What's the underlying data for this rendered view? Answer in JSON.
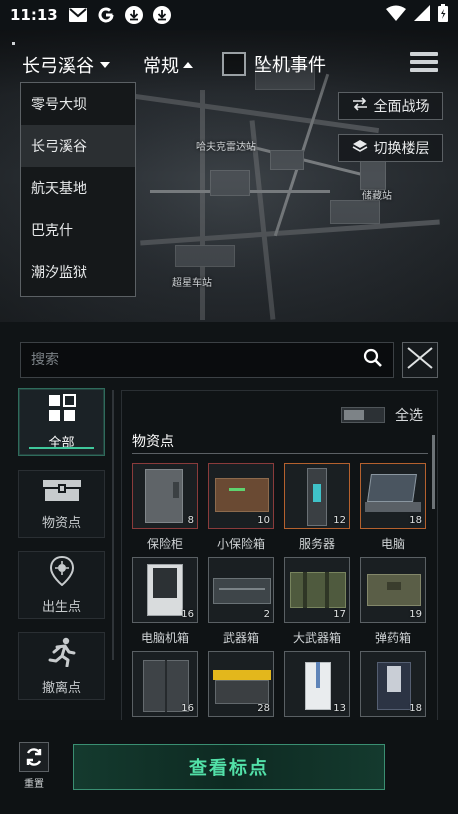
{
  "status_bar": {
    "time": "11:13",
    "icons": [
      "gmail-icon",
      "google-icon",
      "download-icon",
      "download-icon",
      "wifi-icon",
      "signal-icon",
      "battery-icon"
    ]
  },
  "header": {
    "map_selected": "长弓溪谷",
    "mode": "常规",
    "crash_event_label": "坠机事件"
  },
  "map_dropdown": {
    "options": [
      "零号大坝",
      "长弓溪谷",
      "航天基地",
      "巴克什",
      "潮汐监狱"
    ],
    "selected": "长弓溪谷"
  },
  "map_buttons": {
    "full_battlefield": "全面战场",
    "switch_floor": "切换楼层"
  },
  "map_places": {
    "p1": "哈夫克雷达站",
    "p2": "储藏站",
    "p3": "超星车站"
  },
  "search": {
    "placeholder": "搜索"
  },
  "categories": [
    {
      "label": "全部",
      "icon": "grid-icon",
      "active": true
    },
    {
      "label": "物资点",
      "icon": "crate-icon",
      "active": false
    },
    {
      "label": "出生点",
      "icon": "spawn-pin-icon",
      "active": false
    },
    {
      "label": "撤离点",
      "icon": "running-man-icon",
      "active": false
    }
  ],
  "grid": {
    "select_all": "全选",
    "section_title": "物资点",
    "items": [
      {
        "label": "保险柜",
        "count": "8",
        "frame": "red"
      },
      {
        "label": "小保险箱",
        "count": "10",
        "frame": "red"
      },
      {
        "label": "服务器",
        "count": "12",
        "frame": "orange"
      },
      {
        "label": "电脑",
        "count": "18",
        "frame": "orange"
      },
      {
        "label": "电脑机箱",
        "count": "16",
        "frame": "grey"
      },
      {
        "label": "武器箱",
        "count": "2",
        "frame": "grey"
      },
      {
        "label": "大武器箱",
        "count": "17",
        "frame": "grey"
      },
      {
        "label": "弹药箱",
        "count": "19",
        "frame": "grey"
      },
      {
        "label": "",
        "count": "16",
        "frame": "grey"
      },
      {
        "label": "",
        "count": "28",
        "frame": "grey"
      },
      {
        "label": "",
        "count": "13",
        "frame": "grey"
      },
      {
        "label": "",
        "count": "18",
        "frame": "grey"
      }
    ]
  },
  "footer": {
    "reset_label": "重置",
    "view_markers_label": "查看标点"
  },
  "colors": {
    "accent_green": "#52e0a8",
    "frame_red": "#8a3b3b",
    "frame_orange": "#b5612e"
  }
}
